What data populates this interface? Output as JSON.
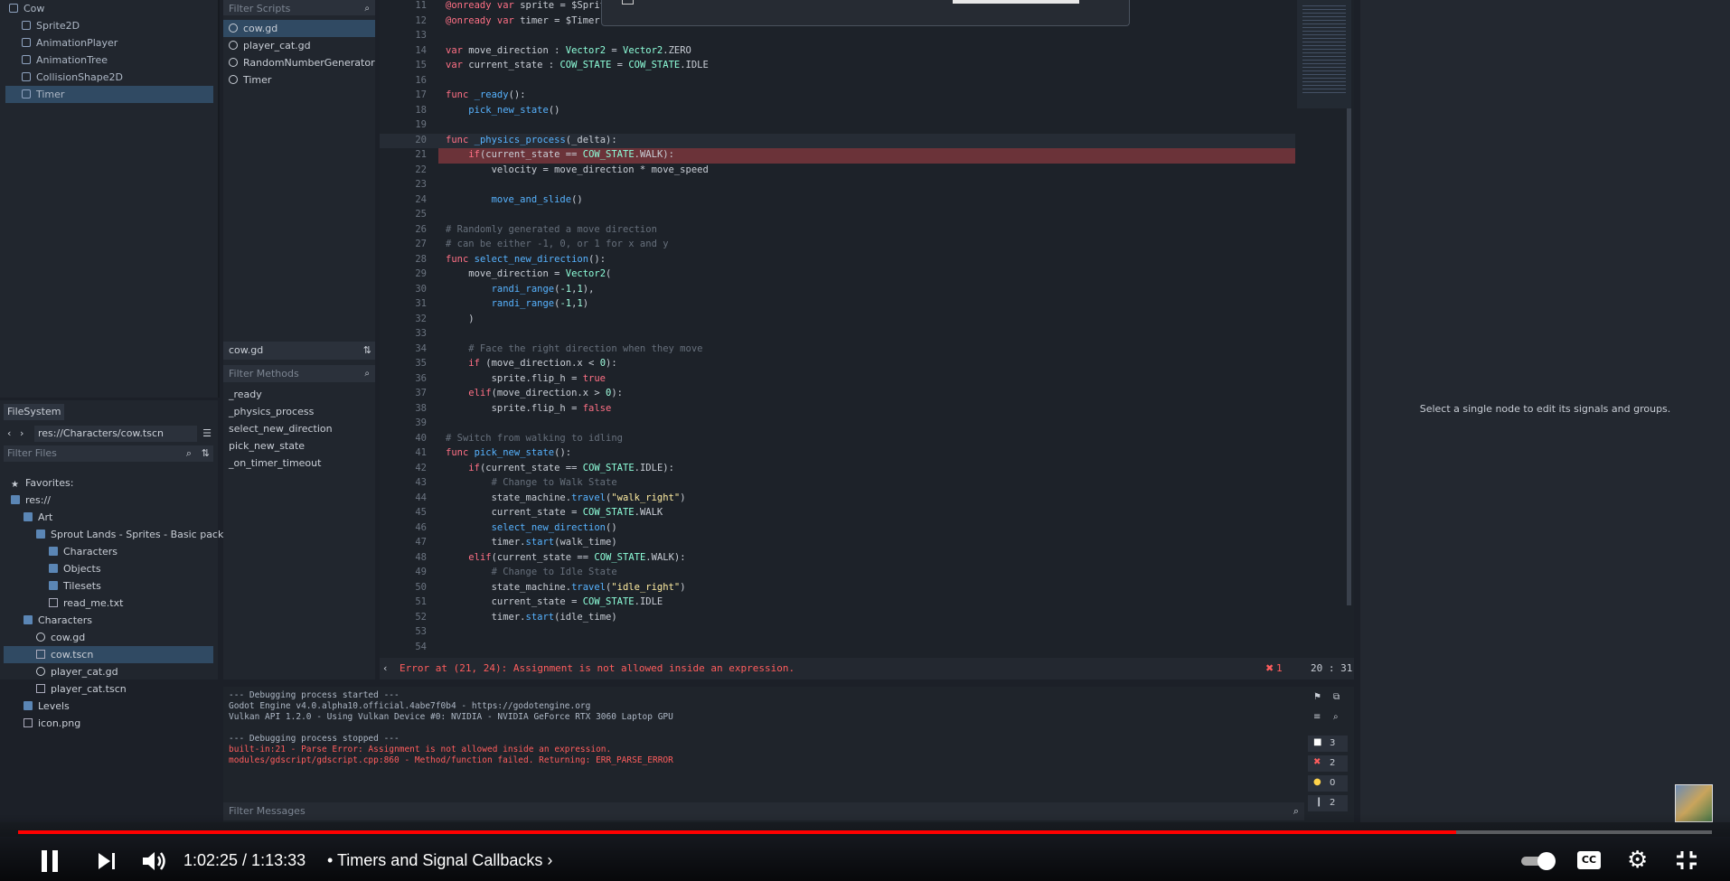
{
  "scene_tree": {
    "items": [
      {
        "label": "Cow",
        "depth": 0
      },
      {
        "label": "Sprite2D",
        "depth": 1
      },
      {
        "label": "AnimationPlayer",
        "depth": 1
      },
      {
        "label": "AnimationTree",
        "depth": 1
      },
      {
        "label": "CollisionShape2D",
        "depth": 1
      },
      {
        "label": "Timer",
        "depth": 1,
        "selected": true
      }
    ]
  },
  "script_list": {
    "filter_placeholder": "Filter Scripts",
    "items": [
      "cow.gd",
      "player_cat.gd",
      "RandomNumberGenerator",
      "Timer"
    ],
    "current_file": "cow.gd",
    "methods_placeholder": "Filter Methods",
    "methods": [
      "_ready",
      "_physics_process",
      "select_new_direction",
      "pick_new_state",
      "_on_timer_timeout"
    ]
  },
  "filesystem": {
    "tab": "FileSystem",
    "path": "res://Characters/cow.tscn",
    "filter_placeholder": "Filter Files",
    "items": [
      {
        "label": "Favorites:",
        "depth": 0,
        "type": "star"
      },
      {
        "label": "res://",
        "depth": 0,
        "type": "folder"
      },
      {
        "label": "Art",
        "depth": 1,
        "type": "folder"
      },
      {
        "label": "Sprout Lands - Sprites - Basic pack",
        "depth": 2,
        "type": "folder"
      },
      {
        "label": "Characters",
        "depth": 3,
        "type": "folder"
      },
      {
        "label": "Objects",
        "depth": 3,
        "type": "folder"
      },
      {
        "label": "Tilesets",
        "depth": 3,
        "type": "folder"
      },
      {
        "label": "read_me.txt",
        "depth": 3,
        "type": "file"
      },
      {
        "label": "Characters",
        "depth": 1,
        "type": "folder"
      },
      {
        "label": "cow.gd",
        "depth": 2,
        "type": "gear"
      },
      {
        "label": "cow.tscn",
        "depth": 2,
        "type": "file",
        "selected": true
      },
      {
        "label": "player_cat.gd",
        "depth": 2,
        "type": "gear"
      },
      {
        "label": "player_cat.tscn",
        "depth": 2,
        "type": "file"
      },
      {
        "label": "Levels",
        "depth": 1,
        "type": "folder"
      },
      {
        "label": "icon.png",
        "depth": 1,
        "type": "file"
      }
    ]
  },
  "code": {
    "lines": [
      {
        "n": "11",
        "t": "@onready var sprite = $Sprit"
      },
      {
        "n": "12",
        "t": "@onready var timer = $Timer"
      },
      {
        "n": "13",
        "t": ""
      },
      {
        "n": "14",
        "t": "var move_direction : Vector2 = Vector2.ZERO"
      },
      {
        "n": "15",
        "t": "var current_state : COW_STATE = COW_STATE.IDLE"
      },
      {
        "n": "16",
        "t": ""
      },
      {
        "n": "17",
        "t": "func _ready():"
      },
      {
        "n": "18",
        "t": "    pick_new_state()"
      },
      {
        "n": "19",
        "t": ""
      },
      {
        "n": "20",
        "t": "func _physics_process(_delta):"
      },
      {
        "n": "21",
        "t": "    if(current_state == COW_STATE.WALK):"
      },
      {
        "n": "22",
        "t": "        velocity = move_direction * move_speed"
      },
      {
        "n": "23",
        "t": ""
      },
      {
        "n": "24",
        "t": "        move_and_slide()"
      },
      {
        "n": "25",
        "t": ""
      },
      {
        "n": "26",
        "t": "# Randomly generated a move direction"
      },
      {
        "n": "27",
        "t": "# can be either -1, 0, or 1 for x and y"
      },
      {
        "n": "28",
        "t": "func select_new_direction():"
      },
      {
        "n": "29",
        "t": "    move_direction = Vector2("
      },
      {
        "n": "30",
        "t": "        randi_range(-1,1),"
      },
      {
        "n": "31",
        "t": "        randi_range(-1,1)"
      },
      {
        "n": "32",
        "t": "    )"
      },
      {
        "n": "33",
        "t": ""
      },
      {
        "n": "34",
        "t": "    # Face the right direction when they move"
      },
      {
        "n": "35",
        "t": "    if (move_direction.x < 0):"
      },
      {
        "n": "36",
        "t": "        sprite.flip_h = true"
      },
      {
        "n": "37",
        "t": "    elif(move_direction.x > 0):"
      },
      {
        "n": "38",
        "t": "        sprite.flip_h = false"
      },
      {
        "n": "39",
        "t": ""
      },
      {
        "n": "40",
        "t": "# Switch from walking to idling"
      },
      {
        "n": "41",
        "t": "func pick_new_state():"
      },
      {
        "n": "42",
        "t": "    if(current_state == COW_STATE.IDLE):"
      },
      {
        "n": "43",
        "t": "        # Change to Walk State"
      },
      {
        "n": "44",
        "t": "        state_machine.travel(\"walk_right\")"
      },
      {
        "n": "45",
        "t": "        current_state = COW_STATE.WALK"
      },
      {
        "n": "46",
        "t": "        select_new_direction()"
      },
      {
        "n": "47",
        "t": "        timer.start(walk_time)"
      },
      {
        "n": "48",
        "t": "    elif(current_state == COW_STATE.WALK):"
      },
      {
        "n": "49",
        "t": "        # Change to Idle State"
      },
      {
        "n": "50",
        "t": "        state_machine.travel(\"idle_right\")"
      },
      {
        "n": "51",
        "t": "        current_state = COW_STATE.IDLE"
      },
      {
        "n": "52",
        "t": "        timer.start(idle_time)"
      },
      {
        "n": "53",
        "t": ""
      },
      {
        "n": "54",
        "t": ""
      }
    ],
    "error_text": "Error at (21, 24): Assignment is not allowed inside an expression.",
    "error_count": "1",
    "cursor": "20 :  31"
  },
  "output": {
    "lines": [
      {
        "t": "--- Debugging process started ---",
        "err": false
      },
      {
        "t": "Godot Engine v4.0.alpha10.official.4abe7f0b4 - https://godotengine.org",
        "err": false
      },
      {
        "t": "Vulkan API 1.2.0 - Using Vulkan Device #0: NVIDIA - NVIDIA GeForce RTX 3060 Laptop GPU",
        "err": false
      },
      {
        "t": "",
        "err": false
      },
      {
        "t": "--- Debugging process stopped ---",
        "err": false
      },
      {
        "t": "built-in:21 - Parse Error: Assignment is not allowed inside an expression.",
        "err": true
      },
      {
        "t": "modules/gdscript/gdscript.cpp:860 - Method/function failed. Returning: ERR_PARSE_ERROR",
        "err": true
      }
    ],
    "filter_placeholder": "Filter Messages",
    "counts": [
      "3",
      "2",
      "0",
      "2"
    ]
  },
  "node_panel": {
    "message": "Select a single node to edit its signals and groups."
  },
  "player": {
    "time": "1:02:25 / 1:13:33",
    "chapter": "• Timers and Signal Callbacks ›",
    "progress": 0.849
  },
  "colors": {
    "accent": "#ff0000",
    "error": "#ff5d5d",
    "selection": "#304a63"
  }
}
